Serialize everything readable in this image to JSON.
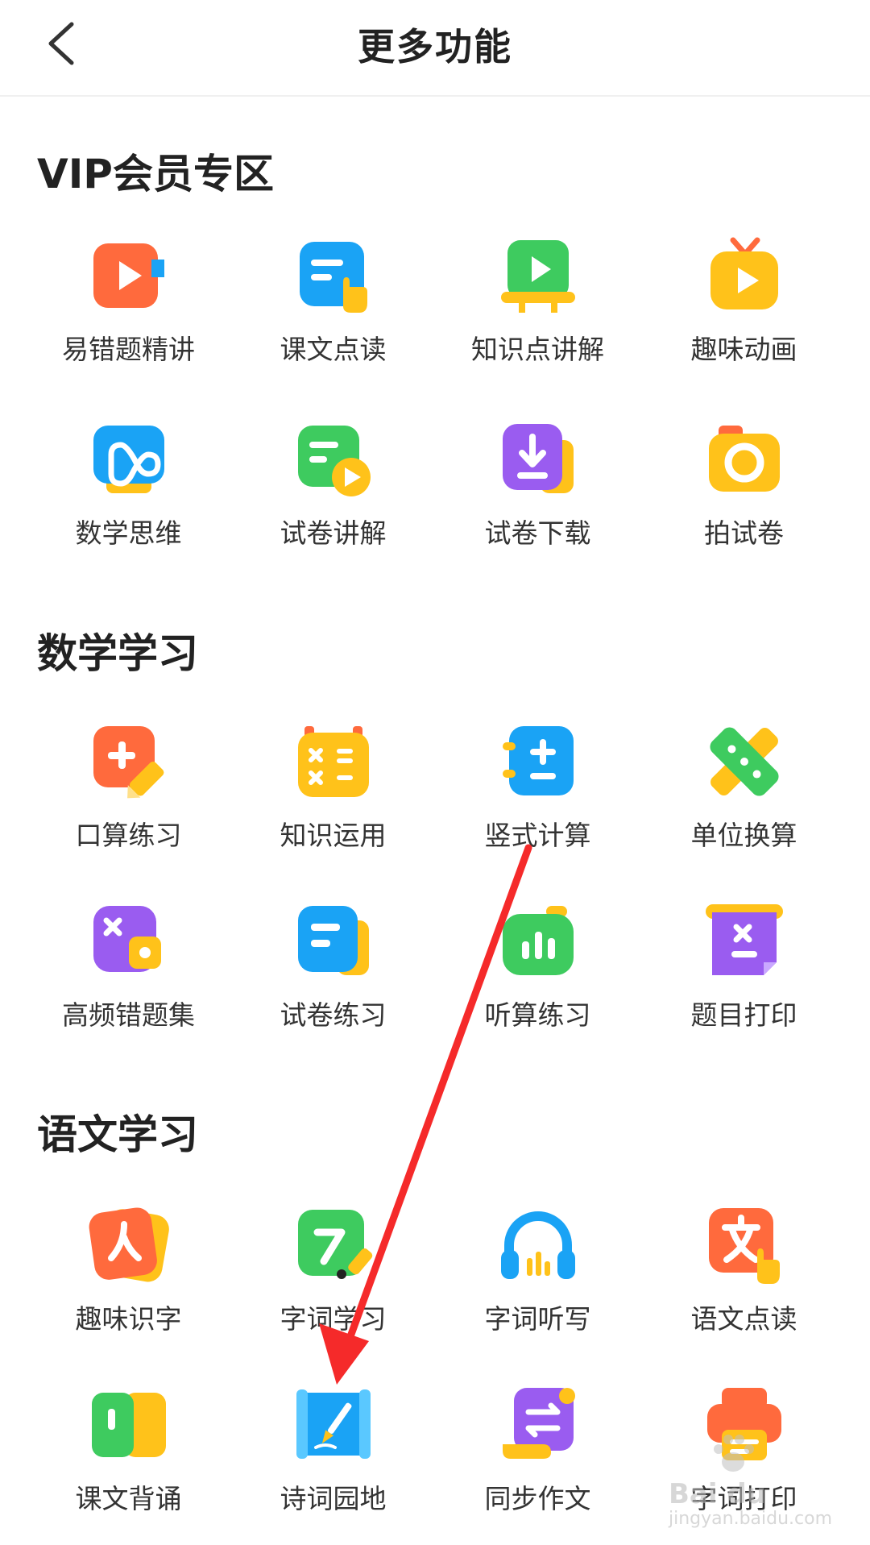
{
  "header": {
    "title": "更多功能"
  },
  "sections": [
    {
      "title": "VIP会员专区",
      "items": [
        {
          "label": "易错题精讲",
          "icon": "video-tag-icon"
        },
        {
          "label": "课文点读",
          "icon": "text-tap-icon"
        },
        {
          "label": "知识点讲解",
          "icon": "video-board-icon"
        },
        {
          "label": "趣味动画",
          "icon": "tv-play-icon"
        },
        {
          "label": "数学思维",
          "icon": "infinity-icon"
        },
        {
          "label": "试卷讲解",
          "icon": "paper-play-icon"
        },
        {
          "label": "试卷下载",
          "icon": "download-doc-icon"
        },
        {
          "label": "拍试卷",
          "icon": "camera-icon"
        }
      ]
    },
    {
      "title": "数学学习",
      "items": [
        {
          "label": "口算练习",
          "icon": "plus-pencil-icon"
        },
        {
          "label": "知识运用",
          "icon": "calculator-calendar-icon"
        },
        {
          "label": "竖式计算",
          "icon": "calculator-icon"
        },
        {
          "label": "单位换算",
          "icon": "ruler-icon"
        },
        {
          "label": "高频错题集",
          "icon": "wrong-collection-icon"
        },
        {
          "label": "试卷练习",
          "icon": "paper-icon"
        },
        {
          "label": "听算练习",
          "icon": "audio-bars-icon"
        },
        {
          "label": "题目打印",
          "icon": "question-print-icon"
        }
      ]
    },
    {
      "title": "语文学习",
      "items": [
        {
          "label": "趣味识字",
          "icon": "character-card-icon"
        },
        {
          "label": "字词学习",
          "icon": "stroke-pen-icon"
        },
        {
          "label": "字词听写",
          "icon": "headphones-icon"
        },
        {
          "label": "语文点读",
          "icon": "wen-tap-icon"
        },
        {
          "label": "课文背诵",
          "icon": "book-recite-icon"
        },
        {
          "label": "诗词园地",
          "icon": "scroll-brush-icon"
        },
        {
          "label": "同步作文",
          "icon": "essay-swap-icon"
        },
        {
          "label": "字词打印",
          "icon": "printer-icon"
        }
      ]
    }
  ],
  "colors": {
    "orange": "#ff6a3d",
    "blue": "#1aa3f5",
    "green": "#3ecb5f",
    "yellow": "#ffc21a",
    "purple": "#9a5cf0",
    "red_arrow": "#f52a2a"
  },
  "watermark": {
    "brand": "Bai du",
    "site": "jingyan.baidu.com"
  }
}
